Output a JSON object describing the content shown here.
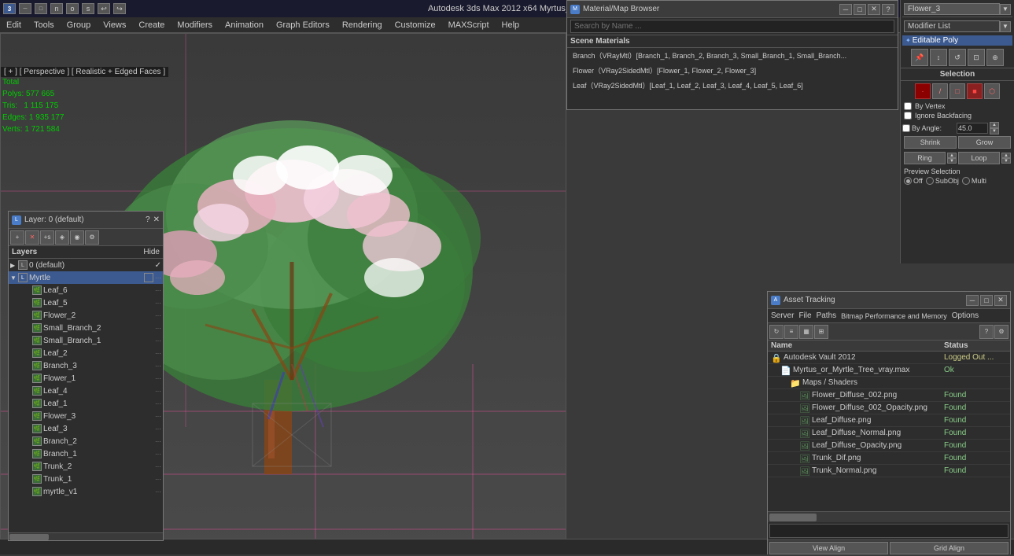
{
  "app": {
    "title": "Autodesk 3ds Max 2012 x64    Myrtus_or_Myrtle_Tree_vray.max",
    "icon": "3ds-max-icon"
  },
  "titlebar": {
    "controls": [
      "minimize",
      "maximize",
      "close"
    ]
  },
  "menubar": {
    "items": [
      "Edit",
      "Tools",
      "Group",
      "Views",
      "Create",
      "Modifiers",
      "Animation",
      "Graph Editors",
      "Rendering",
      "Customize",
      "MAXScript",
      "Help"
    ]
  },
  "viewport": {
    "label": "[ + ] [ Perspective ] [ Realistic + Edged Faces ]",
    "stats": {
      "label": "Total",
      "polys": "577 665",
      "tris": "1 115 175",
      "edges": "1 935 177",
      "verts": "1 721 584"
    },
    "grid_color": "#e84f9a"
  },
  "layers_panel": {
    "title": "Layer: 0 (default)",
    "question": "?",
    "header_layers": "Layers",
    "header_hide": "Hide",
    "items": [
      {
        "name": "0 (default)",
        "indent": 0,
        "checked": true,
        "active": false,
        "type": "layer"
      },
      {
        "name": "Myrtle",
        "indent": 0,
        "checked": false,
        "active": true,
        "type": "layer"
      },
      {
        "name": "Leaf_6",
        "indent": 1,
        "checked": false,
        "active": false,
        "type": "object"
      },
      {
        "name": "Leaf_5",
        "indent": 1,
        "checked": false,
        "active": false,
        "type": "object"
      },
      {
        "name": "Flower_2",
        "indent": 1,
        "checked": false,
        "active": false,
        "type": "object"
      },
      {
        "name": "Small_Branch_2",
        "indent": 1,
        "checked": false,
        "active": false,
        "type": "object"
      },
      {
        "name": "Small_Branch_1",
        "indent": 1,
        "checked": false,
        "active": false,
        "type": "object"
      },
      {
        "name": "Leaf_2",
        "indent": 1,
        "checked": false,
        "active": false,
        "type": "object"
      },
      {
        "name": "Branch_3",
        "indent": 1,
        "checked": false,
        "active": false,
        "type": "object"
      },
      {
        "name": "Flower_1",
        "indent": 1,
        "checked": false,
        "active": false,
        "type": "object"
      },
      {
        "name": "Leaf_4",
        "indent": 1,
        "checked": false,
        "active": false,
        "type": "object"
      },
      {
        "name": "Leaf_1",
        "indent": 1,
        "checked": false,
        "active": false,
        "type": "object"
      },
      {
        "name": "Flower_3",
        "indent": 1,
        "checked": false,
        "active": false,
        "type": "object"
      },
      {
        "name": "Leaf_3",
        "indent": 1,
        "checked": false,
        "active": false,
        "type": "object"
      },
      {
        "name": "Branch_2",
        "indent": 1,
        "checked": false,
        "active": false,
        "type": "object"
      },
      {
        "name": "Branch_1",
        "indent": 1,
        "checked": false,
        "active": false,
        "type": "object"
      },
      {
        "name": "Trunk_2",
        "indent": 1,
        "checked": false,
        "active": false,
        "type": "object"
      },
      {
        "name": "Trunk_1",
        "indent": 1,
        "checked": false,
        "active": false,
        "type": "object"
      },
      {
        "name": "myrtle_v1",
        "indent": 1,
        "checked": false,
        "active": false,
        "type": "object"
      }
    ]
  },
  "material_browser": {
    "title": "Material/Map Browser",
    "search_placeholder": "Search by Name ...",
    "section": "Scene Materials",
    "items": [
      {
        "name": "Branch（VRayMtl）[Branch_1, Branch_2, Branch_3, Small_Branch_1, Small_Branch...",
        "selected": false
      },
      {
        "name": "Flower（VRay2SidedMtl）[Flower_1, Flower_2, Flower_3]",
        "selected": false
      },
      {
        "name": "Leaf（VRay2SidedMtl）[Leaf_1, Leaf_2, Leaf_3, Leaf_4, Leaf_5, Leaf_6]",
        "selected": false
      }
    ]
  },
  "modifier_panel": {
    "dropdown_label": "Flower_3",
    "modifier_list_label": "Modifier List",
    "active_modifier": "Editable Poly",
    "selection_title": "Selection",
    "by_vertex_label": "By Vertex",
    "ignore_backfacing_label": "Ignore Backfacing",
    "by_angle_label": "By Angle:",
    "by_angle_value": "45.0",
    "shrink_label": "Shrink",
    "grow_label": "Grow",
    "ring_label": "Ring",
    "loop_label": "Loop",
    "preview_selection_label": "Preview Selection",
    "off_label": "Off",
    "subobj_label": "SubObj",
    "multi_label": "Multi"
  },
  "asset_tracking": {
    "title": "Asset Tracking",
    "menu_items": [
      "Server",
      "File",
      "Paths",
      "Bitmap Performance and Memory",
      "Options"
    ],
    "col_name": "Name",
    "col_status": "Status",
    "items": [
      {
        "name": "Autodesk Vault 2012",
        "status": "Logged Out ...",
        "type": "vault",
        "indent": 0
      },
      {
        "name": "Myrtus_or_Myrtle_Tree_vray.max",
        "status": "Ok",
        "type": "max",
        "indent": 1
      },
      {
        "name": "Maps / Shaders",
        "status": "",
        "type": "folder",
        "indent": 2
      },
      {
        "name": "Flower_Diffuse_002.png",
        "status": "Found",
        "type": "map",
        "indent": 3
      },
      {
        "name": "Flower_Diffuse_002_Opacity.png",
        "status": "Found",
        "type": "map",
        "indent": 3
      },
      {
        "name": "Leaf_Diffuse.png",
        "status": "Found",
        "type": "map",
        "indent": 3
      },
      {
        "name": "Leaf_Diffuse_Normal.png",
        "status": "Found",
        "type": "map",
        "indent": 3
      },
      {
        "name": "Leaf_Diffuse_Opacity.png",
        "status": "Found",
        "type": "map",
        "indent": 3
      },
      {
        "name": "Trunk_Dif.png",
        "status": "Found",
        "type": "map",
        "indent": 3
      },
      {
        "name": "Trunk_Normal.png",
        "status": "Found",
        "type": "map",
        "indent": 3
      }
    ],
    "bottom_buttons": [
      "View Align",
      "Grid Align"
    ]
  },
  "status_bar": {
    "text": ""
  }
}
